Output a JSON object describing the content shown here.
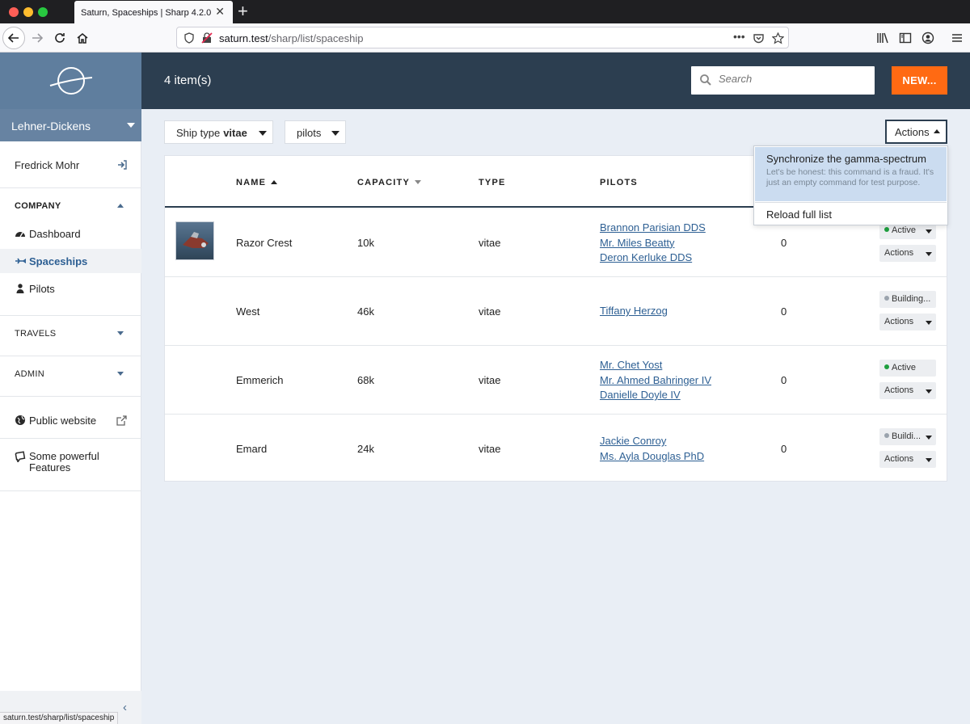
{
  "browser": {
    "tab_title": "Saturn, Spaceships | Sharp 4.2.0",
    "url_host": "saturn.test",
    "url_path": "/sharp/list/spaceship",
    "status_url": "saturn.test/sharp/list/spaceship"
  },
  "sidebar": {
    "company": "Lehner-Dickens",
    "user": "Fredrick Mohr",
    "sections": {
      "company": "COMPANY",
      "travels": "TRAVELS",
      "admin": "ADMIN"
    },
    "items": {
      "dashboard": "Dashboard",
      "spaceships": "Spaceships",
      "pilots": "Pilots",
      "public_website": "Public website",
      "features_1": "Some powerful",
      "features_2": "Features"
    }
  },
  "header": {
    "count": "4 item(s)",
    "search_placeholder": "Search",
    "new_label": "NEW..."
  },
  "filters": {
    "ship_type_label": "Ship type",
    "ship_type_value": "vitae",
    "pilots_label": "pilots",
    "actions_label": "Actions"
  },
  "actions_menu": {
    "item1_label": "Synchronize the gamma-spectrum",
    "item1_desc": "Let's be honest: this command is a fraud. It's just an empty command for test purpose.",
    "item2_label": "Reload full list"
  },
  "table": {
    "headers": {
      "name": "NAME",
      "capacity": "CAPACITY",
      "type": "TYPE",
      "pilots": "PILOTS"
    },
    "rows": [
      {
        "name": "Razor Crest",
        "capacity": "10k",
        "type": "vitae",
        "pilots": [
          "Brannon Parisian DDS",
          "Mr. Miles Beatty",
          "Deron Kerluke DDS"
        ],
        "count": "0",
        "state": "Active",
        "state_color": "#1e9e3e",
        "actions": "Actions"
      },
      {
        "name": "West",
        "capacity": "46k",
        "type": "vitae",
        "pilots": [
          "Tiffany Herzog"
        ],
        "count": "0",
        "state": "Building...",
        "state_color": "#9aa3ad",
        "actions": "Actions"
      },
      {
        "name": "Emmerich",
        "capacity": "68k",
        "type": "vitae",
        "pilots": [
          "Mr. Chet Yost",
          "Mr. Ahmed Bahringer IV",
          "Danielle Doyle IV"
        ],
        "count": "0",
        "state": "Active",
        "state_color": "#1e9e3e",
        "actions": "Actions"
      },
      {
        "name": "Emard",
        "capacity": "24k",
        "type": "vitae",
        "pilots": [
          "Jackie Conroy",
          "Ms. Ayla Douglas PhD"
        ],
        "count": "0",
        "state": "Buildi...",
        "state_color": "#9aa3ad",
        "actions": "Actions"
      }
    ]
  }
}
